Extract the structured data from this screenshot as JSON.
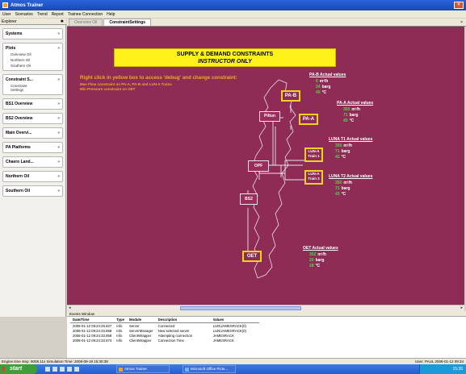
{
  "window": {
    "title": "Atmos Trainer"
  },
  "menu": [
    "User",
    "Scenarios",
    "Trend",
    "Report",
    "Trainee Connection",
    "Help"
  ],
  "explorer": {
    "title": "Explorer",
    "pin": "✱"
  },
  "sidebar": {
    "groups": [
      {
        "title": "Systems",
        "items": []
      },
      {
        "title": "Plots",
        "items": [
          "Overview Oil",
          "Northern Oil",
          "Southern Oil"
        ]
      },
      {
        "title": "Constraint S...",
        "items": [
          "Constraint",
          "Settings"
        ]
      },
      {
        "title": "BS1 Overview",
        "items": []
      },
      {
        "title": "BS2 Overview",
        "items": []
      },
      {
        "title": "Main Overvi...",
        "items": []
      },
      {
        "title": "PA Platforms",
        "items": []
      },
      {
        "title": "Chaero Land...",
        "items": []
      },
      {
        "title": "Northern Oil",
        "items": []
      },
      {
        "title": "Southern Oil",
        "items": []
      }
    ]
  },
  "tabs": [
    {
      "label": "Overview Oil",
      "active": false
    },
    {
      "label": "ConstraintSettings",
      "active": true
    }
  ],
  "tab_close": "×",
  "banner": {
    "title": "SUPPLY & DEMAND CONSTRAINTS",
    "subtitle": "INSTRUCTOR ONLY"
  },
  "instructions": {
    "line1": "Right click in yellow box to access 'debug' and change constraint:",
    "line2": "Max Flow constraint on PA-A, PA-B and LUN-A Trains",
    "line3": "Min Pressure constraint on OET"
  },
  "nodes": {
    "pa_b": "PA-B",
    "pa_a": "PA-A",
    "piltun": "Piltun",
    "opf": "OPF",
    "bs2": "BS2",
    "oet": "OET",
    "luna_t1": [
      "LUN-A",
      "Train 1"
    ],
    "luna_t2": [
      "LUN-A",
      "Train 2"
    ]
  },
  "readouts": {
    "pa_b": {
      "title": "PA-B Actual values",
      "flow": "6",
      "pressure": "24",
      "temp": "40"
    },
    "pa_a": {
      "title": "PA-A Actual values",
      "flow": "350",
      "pressure": "71",
      "temp": "45"
    },
    "luna_t1": {
      "title": "LUNA T1 Actual values",
      "flow": "350",
      "pressure": "71",
      "temp": "42"
    },
    "luna_t2": {
      "title": "LUNA T2 Actual values",
      "flow": "350",
      "pressure": "71",
      "temp": "43"
    },
    "oet": {
      "title": "OET Actual values",
      "flow": "352",
      "pressure": "20",
      "temp": "28"
    }
  },
  "units": {
    "flow": "m³/h",
    "pressure": "barg",
    "temp": "°C"
  },
  "events": {
    "window_title": "Events Window",
    "columns": [
      "Date/Time",
      "Type",
      "Module",
      "Description",
      "Values"
    ],
    "rows": [
      [
        "2008-01-12 09:24:29.827",
        "Info",
        "Server",
        "Connected",
        "LUN\\JAMESRACK(0)"
      ],
      [
        "2008-01-12 09:24:33.858",
        "Info",
        "ServerManager",
        "New selected server",
        "LUN\\JAMESRACK(0)"
      ],
      [
        "2008-01-12 09:24:33.858",
        "Info",
        "ClientWrapper",
        "Attempting connection",
        "JAMESRACK"
      ],
      [
        "2008-01-12 09:24:33.874",
        "Info",
        "ClientWrapper",
        "Connection Time",
        "JAMESRACK"
      ]
    ]
  },
  "status": {
    "left": "Engine time step: 9008.11s    Simulation Time: 2008-09-19 15:30:38",
    "right": "User: PAUL    2008-01-12 09:34"
  },
  "taskbar": {
    "start": "start",
    "tasks": [
      "Atmos Trainer",
      "Microsoft Office Pictu..."
    ],
    "clock": "15:36"
  }
}
